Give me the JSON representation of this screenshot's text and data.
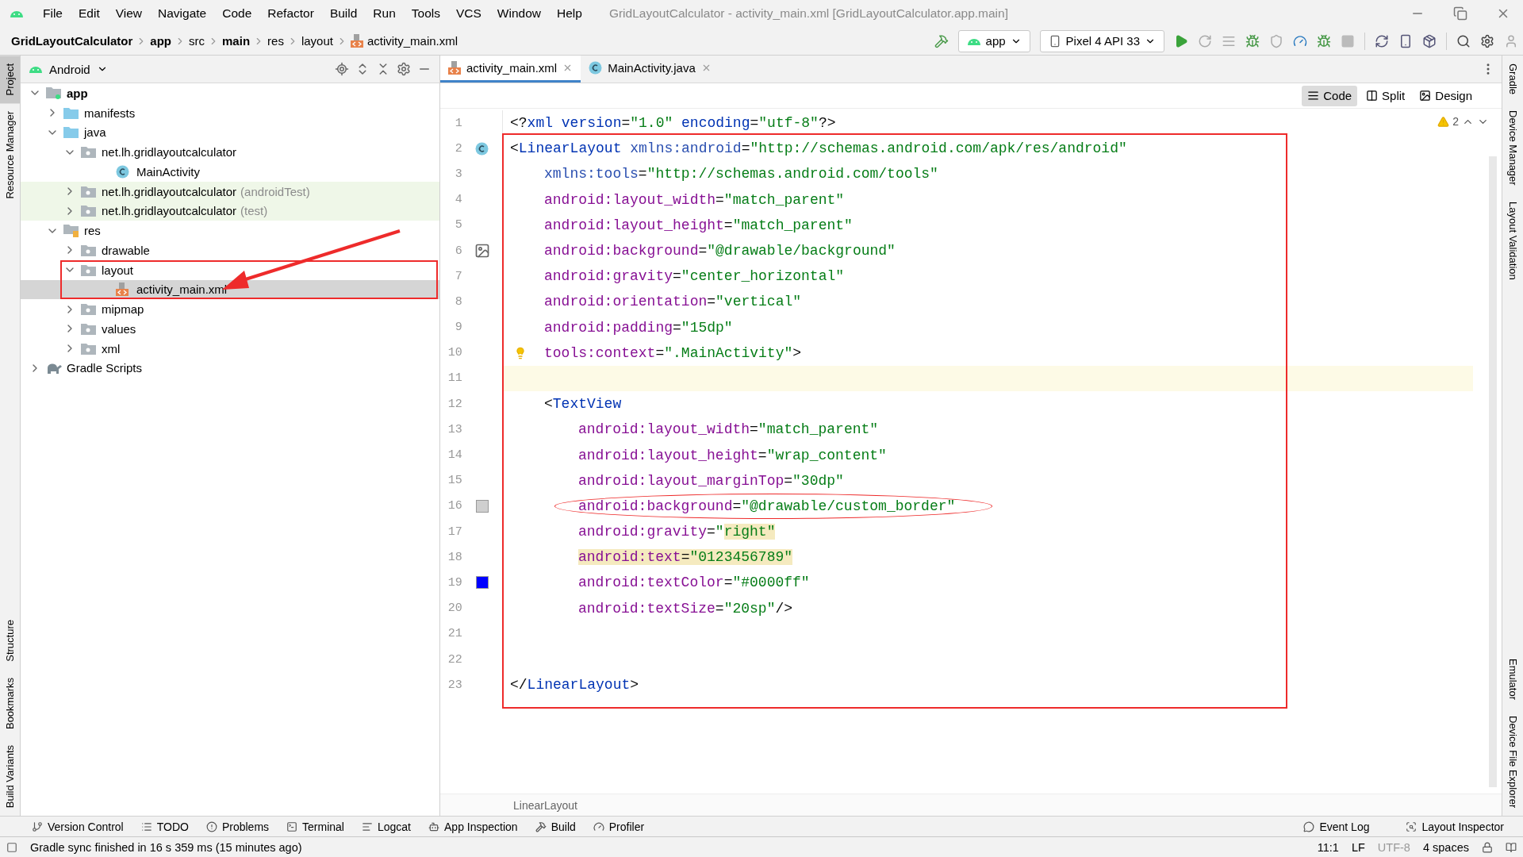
{
  "window": {
    "title": "GridLayoutCalculator - activity_main.xml [GridLayoutCalculator.app.main]"
  },
  "menu": [
    "File",
    "Edit",
    "View",
    "Navigate",
    "Code",
    "Refactor",
    "Build",
    "Run",
    "Tools",
    "VCS",
    "Window",
    "Help"
  ],
  "breadcrumb": [
    {
      "label": "GridLayoutCalculator",
      "kind": "bold"
    },
    {
      "label": "app",
      "kind": "bold"
    },
    {
      "label": "src",
      "kind": "plain"
    },
    {
      "label": "main",
      "kind": "bold"
    },
    {
      "label": "res",
      "kind": "plain"
    },
    {
      "label": "layout",
      "kind": "plain"
    },
    {
      "label": "activity_main.xml",
      "kind": "xml-file"
    }
  ],
  "toolbar": {
    "run_config": "app",
    "device": "Pixel 4 API 33"
  },
  "left_strip": {
    "top": [
      {
        "label": "Project",
        "selected": true
      },
      {
        "label": "Resource Manager",
        "selected": false
      }
    ],
    "bottom": [
      {
        "label": "Structure",
        "selected": false
      },
      {
        "label": "Bookmarks",
        "selected": false
      },
      {
        "label": "Build Variants",
        "selected": false
      }
    ]
  },
  "right_strip": {
    "top": [
      {
        "label": "Gradle"
      },
      {
        "label": "Device Manager"
      },
      {
        "label": "Layout Validation"
      }
    ],
    "bottom": [
      {
        "label": "Emulator"
      },
      {
        "label": "Device File Explorer"
      }
    ]
  },
  "project_panel": {
    "view": "Android",
    "annotation_arrow": true,
    "tree": [
      {
        "label": "app",
        "kind": "module",
        "expanded": true,
        "selected": false,
        "children": [
          {
            "label": "manifests",
            "kind": "source-folder",
            "expanded": false,
            "selected": false
          },
          {
            "label": "java",
            "kind": "source-folder",
            "expanded": true,
            "selected": false,
            "children": [
              {
                "label": "net.lh.gridlayoutcalculator",
                "kind": "package",
                "expanded": true,
                "selected": false,
                "children": [
                  {
                    "label": "MainActivity",
                    "kind": "class",
                    "selected": false
                  }
                ]
              },
              {
                "label": "net.lh.gridlayoutcalculator",
                "suffix": "(androidTest)",
                "kind": "test-package",
                "expanded": false,
                "selected": false
              },
              {
                "label": "net.lh.gridlayoutcalculator",
                "suffix": "(test)",
                "kind": "test-package",
                "expanded": false,
                "selected": false
              }
            ]
          },
          {
            "label": "res",
            "kind": "res-folder",
            "expanded": true,
            "selected": false,
            "children": [
              {
                "label": "drawable",
                "kind": "package",
                "expanded": false,
                "selected": false
              },
              {
                "label": "layout",
                "kind": "package",
                "expanded": true,
                "selected": false,
                "outlined": true,
                "children": [
                  {
                    "label": "activity_main.xml",
                    "kind": "xml-file",
                    "selected": true
                  }
                ]
              },
              {
                "label": "mipmap",
                "kind": "package",
                "expanded": false,
                "selected": false
              },
              {
                "label": "values",
                "kind": "package",
                "expanded": false,
                "selected": false
              },
              {
                "label": "xml",
                "kind": "package",
                "expanded": false,
                "selected": false
              }
            ]
          }
        ]
      },
      {
        "label": "Gradle Scripts",
        "kind": "gradle",
        "expanded": false,
        "selected": false
      }
    ]
  },
  "editor": {
    "tabs": [
      {
        "label": "activity_main.xml",
        "kind": "xml-file",
        "selected": true
      },
      {
        "label": "MainActivity.java",
        "kind": "class",
        "selected": false
      }
    ],
    "modes": [
      {
        "label": "Code",
        "kind": "code",
        "selected": true
      },
      {
        "label": "Split",
        "kind": "split",
        "selected": false
      },
      {
        "label": "Design",
        "kind": "design",
        "selected": false
      }
    ],
    "warnings": "2",
    "header_lines": [
      {
        "number": "1",
        "kind": "level0",
        "current": false,
        "circled": false,
        "segments": [
          {
            "kind": "plain",
            "text": "<?"
          },
          {
            "kind": "tag",
            "text": "xml version"
          },
          {
            "kind": "plain",
            "text": "="
          },
          {
            "kind": "value",
            "text": "\"1.0\""
          },
          {
            "kind": "tag",
            "text": "encoding",
            "spaced": true
          },
          {
            "kind": "plain",
            "text": "="
          },
          {
            "kind": "value",
            "text": "\"utf-8\""
          },
          {
            "kind": "plain",
            "text": "?>"
          }
        ]
      }
    ],
    "boxed_lines": [
      {
        "number": "2",
        "kind": "level0",
        "current": false,
        "circled": false,
        "marker": {
          "kind": "class"
        },
        "segments": [
          {
            "kind": "plain",
            "text": "<"
          },
          {
            "kind": "tag",
            "text": "LinearLayout"
          },
          {
            "kind": "ns",
            "text": "xmlns:android",
            "spaced": true
          },
          {
            "kind": "plain",
            "text": "="
          },
          {
            "kind": "value",
            "text": "\"http://schemas.android.com/apk/res/android\""
          }
        ]
      },
      {
        "number": "3",
        "kind": "level1",
        "current": false,
        "circled": false,
        "segments": [
          {
            "kind": "ns",
            "text": "xmlns:tools"
          },
          {
            "kind": "plain",
            "text": "="
          },
          {
            "kind": "value",
            "text": "\"http://schemas.android.com/tools\""
          }
        ]
      },
      {
        "number": "4",
        "kind": "level1",
        "current": false,
        "circled": false,
        "segments": [
          {
            "kind": "attr",
            "text": "android:layout_width"
          },
          {
            "kind": "plain",
            "text": "="
          },
          {
            "kind": "value",
            "text": "\"match_parent\""
          }
        ]
      },
      {
        "number": "5",
        "kind": "level1",
        "current": false,
        "circled": false,
        "segments": [
          {
            "kind": "attr",
            "text": "android:layout_height"
          },
          {
            "kind": "plain",
            "text": "="
          },
          {
            "kind": "value",
            "text": "\"match_parent\""
          }
        ]
      },
      {
        "number": "6",
        "kind": "level1",
        "current": false,
        "circled": false,
        "marker": {
          "kind": "image"
        },
        "segments": [
          {
            "kind": "attr",
            "text": "android:background"
          },
          {
            "kind": "plain",
            "text": "="
          },
          {
            "kind": "value",
            "text": "\"@drawable/background\""
          }
        ]
      },
      {
        "number": "7",
        "kind": "level1",
        "current": false,
        "circled": false,
        "segments": [
          {
            "kind": "attr",
            "text": "android:gravity"
          },
          {
            "kind": "plain",
            "text": "="
          },
          {
            "kind": "value",
            "text": "\"center_horizontal\""
          }
        ]
      },
      {
        "number": "8",
        "kind": "level1",
        "current": false,
        "circled": false,
        "segments": [
          {
            "kind": "attr",
            "text": "android:orientation"
          },
          {
            "kind": "plain",
            "text": "="
          },
          {
            "kind": "value",
            "text": "\"vertical\""
          }
        ]
      },
      {
        "number": "9",
        "kind": "level1",
        "current": false,
        "circled": false,
        "segments": [
          {
            "kind": "attr",
            "text": "android:padding"
          },
          {
            "kind": "plain",
            "text": "="
          },
          {
            "kind": "value",
            "text": "\"15dp\""
          }
        ]
      },
      {
        "number": "10",
        "kind": "level1",
        "current": false,
        "circled": false,
        "marker": {
          "kind": "bulb"
        },
        "segments": [
          {
            "kind": "attr",
            "text": "tools:context"
          },
          {
            "kind": "plain",
            "text": "="
          },
          {
            "kind": "value",
            "text": "\".MainActivity\""
          },
          {
            "kind": "plain",
            "text": ">"
          }
        ]
      },
      {
        "number": "11",
        "kind": "level0",
        "current": true,
        "circled": false
      },
      {
        "number": "12",
        "kind": "level1",
        "current": false,
        "circled": false,
        "segments": [
          {
            "kind": "plain",
            "text": "<"
          },
          {
            "kind": "tag",
            "text": "TextView"
          }
        ]
      },
      {
        "number": "13",
        "kind": "level2",
        "current": false,
        "circled": false,
        "segments": [
          {
            "kind": "attr",
            "text": "android:layout_width"
          },
          {
            "kind": "plain",
            "text": "="
          },
          {
            "kind": "value",
            "text": "\"match_parent\""
          }
        ]
      },
      {
        "number": "14",
        "kind": "level2",
        "current": false,
        "circled": false,
        "segments": [
          {
            "kind": "attr",
            "text": "android:layout_height"
          },
          {
            "kind": "plain",
            "text": "="
          },
          {
            "kind": "value",
            "text": "\"wrap_content\""
          }
        ]
      },
      {
        "number": "15",
        "kind": "level2",
        "current": false,
        "circled": false,
        "segments": [
          {
            "kind": "attr",
            "text": "android:layout_marginTop"
          },
          {
            "kind": "plain",
            "text": "="
          },
          {
            "kind": "value",
            "text": "\"30dp\""
          }
        ]
      },
      {
        "number": "16",
        "kind": "level2",
        "current": false,
        "circled": true,
        "marker": {
          "kind": "swatch",
          "color": "#cfcfcf"
        },
        "segments": [
          {
            "kind": "attr",
            "text": "android:background"
          },
          {
            "kind": "plain",
            "text": "="
          },
          {
            "kind": "value",
            "text": "\"@drawable/custom_border\""
          }
        ]
      },
      {
        "number": "17",
        "kind": "level2",
        "current": false,
        "circled": false,
        "segments": [
          {
            "kind": "attr",
            "text": "android:gravity"
          },
          {
            "kind": "plain",
            "text": "="
          },
          {
            "kind": "value",
            "text": "\""
          },
          {
            "kind": "value",
            "text": "right\"",
            "highlighted": true
          }
        ]
      },
      {
        "number": "18",
        "kind": "level2",
        "current": false,
        "circled": false,
        "segments": [
          {
            "kind": "attr",
            "text": "android:text",
            "highlighted": true
          },
          {
            "kind": "plain",
            "text": "=",
            "highlighted": true
          },
          {
            "kind": "value",
            "text": "\"0123456789\"",
            "highlighted": true
          }
        ]
      },
      {
        "number": "19",
        "kind": "level2",
        "current": false,
        "circled": false,
        "marker": {
          "kind": "swatch",
          "color": "#0000ff"
        },
        "segments": [
          {
            "kind": "attr",
            "text": "android:textColor"
          },
          {
            "kind": "plain",
            "text": "="
          },
          {
            "kind": "value",
            "text": "\"#0000ff\""
          }
        ]
      },
      {
        "number": "20",
        "kind": "level2",
        "current": false,
        "circled": false,
        "segments": [
          {
            "kind": "attr",
            "text": "android:textSize"
          },
          {
            "kind": "plain",
            "text": "="
          },
          {
            "kind": "value",
            "text": "\"20sp\""
          },
          {
            "kind": "plain",
            "text": "/>"
          }
        ]
      },
      {
        "number": "21",
        "kind": "level0",
        "current": false,
        "circled": false
      },
      {
        "number": "22",
        "kind": "level0",
        "current": false,
        "circled": false
      },
      {
        "number": "23",
        "kind": "level0",
        "current": false,
        "circled": false,
        "segments": [
          {
            "kind": "plain",
            "text": "</"
          },
          {
            "kind": "tag",
            "text": "LinearLayout"
          },
          {
            "kind": "plain",
            "text": ">"
          }
        ]
      }
    ],
    "path": "LinearLayout"
  },
  "tool_windows": {
    "left": [
      {
        "label": "Version Control",
        "kind": "vcs"
      },
      {
        "label": "TODO",
        "kind": "todo"
      },
      {
        "label": "Problems",
        "kind": "problems"
      },
      {
        "label": "Terminal",
        "kind": "terminal"
      },
      {
        "label": "Logcat",
        "kind": "logcat"
      },
      {
        "label": "App Inspection",
        "kind": "inspection"
      },
      {
        "label": "Build",
        "kind": "build"
      },
      {
        "label": "Profiler",
        "kind": "profiler"
      }
    ],
    "right": [
      {
        "label": "Event Log",
        "kind": "event-log"
      },
      {
        "label": "Layout Inspector",
        "kind": "layout-inspector"
      }
    ]
  },
  "status": {
    "message": "Gradle sync finished in 16 s 359 ms (15 minutes ago)",
    "position": "11:1",
    "line_separator": "LF",
    "encoding": "UTF-8",
    "indent": "4 spaces"
  }
}
